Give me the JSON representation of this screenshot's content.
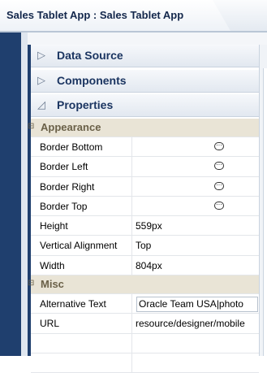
{
  "app": {
    "title": "Sales Tablet App : Sales Tablet App"
  },
  "accordion": [
    {
      "label": "Data Source",
      "icon": "triangle-right-icon"
    },
    {
      "label": "Components",
      "icon": "triangle-right-icon"
    },
    {
      "label": "Properties",
      "icon": "triangle-down-icon"
    }
  ],
  "sections": {
    "appearance": {
      "label": "Appearance",
      "rows": [
        {
          "name": "Border Bottom",
          "value": ""
        },
        {
          "name": "Border Left",
          "value": ""
        },
        {
          "name": "Border Right",
          "value": ""
        },
        {
          "name": "Border Top",
          "value": ""
        },
        {
          "name": "Height",
          "value": "559px"
        },
        {
          "name": "Vertical Alignment",
          "value": "Top"
        },
        {
          "name": "Width",
          "value": "804px"
        }
      ]
    },
    "misc": {
      "label": "Misc",
      "rows": [
        {
          "name": "Alternative Text",
          "value": "Oracle Team USA|photo"
        },
        {
          "name": "URL",
          "value": "resource/designer/mobile"
        }
      ]
    }
  }
}
